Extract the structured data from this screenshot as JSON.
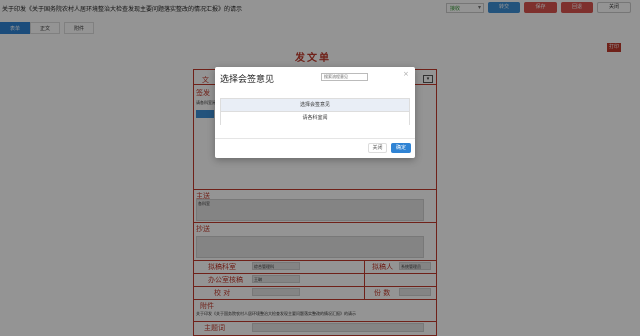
{
  "header": {
    "doc_title": "关于印发《关于国务院农村人居环境整治大检查发现主要问题落实整改的情况汇报》的请示",
    "status_value": "接收",
    "buttons": {
      "transfer": "转交",
      "save": "保存",
      "back": "回退",
      "close": "关闭"
    }
  },
  "tabs": [
    {
      "label": "表单"
    },
    {
      "label": "正文"
    },
    {
      "label": "附件"
    }
  ],
  "form": {
    "title": "发文单",
    "print_label": "打印",
    "labels": {
      "wen": "文",
      "qianfa": "签发",
      "zhusong": "主送",
      "chaosong": "抄送",
      "nigao_keshi": "拟稿科室",
      "nigao_ren": "拟稿人",
      "bangongshi": "办公室核稿",
      "jiaodui": "校  对",
      "fenshu": "份  数",
      "fujian": "附件",
      "zhutici": "主题词",
      "biaoti": "标题"
    },
    "values": {
      "qianfa_note": "请各科室阅",
      "zhusong_value": "各科室",
      "nigao_keshi_value": "综合管理科",
      "nigao_ren_value": "系统管理员",
      "bangongshi_value": "王琳",
      "fujian_value": "关于印发《关于国务院农村人居环境整治大检查发现主要问题落实整改的情况汇报》的请示",
      "biaoti_value": "关于印发《关于国务院农村人居环境整治大检查发现主要问题落实整改的情况汇报》的请示"
    }
  },
  "modal": {
    "title": "选择会签意见",
    "search_placeholder": "搜索流程意见",
    "options": [
      "选择会签意见",
      "请各科室阅"
    ],
    "cancel_label": "关闭",
    "ok_label": "确定"
  }
}
